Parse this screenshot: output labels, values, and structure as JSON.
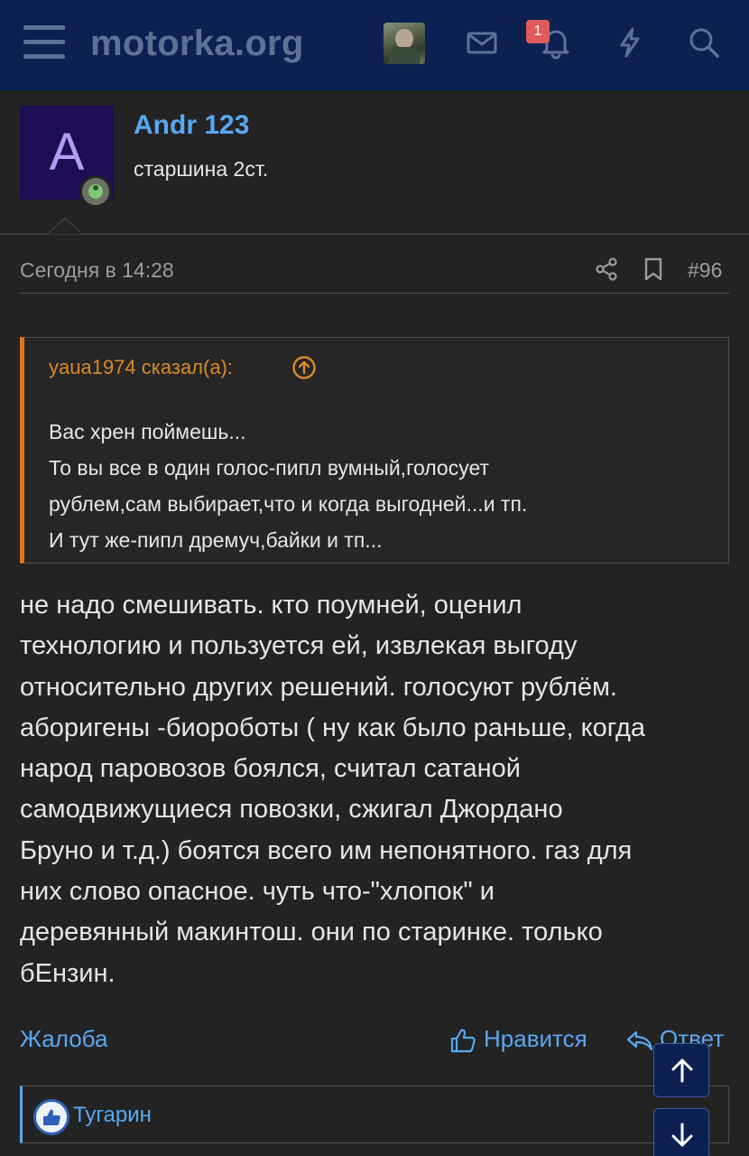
{
  "header": {
    "logo": "motorka.org",
    "notification_count": "1"
  },
  "post": {
    "author_name": "Andr 123",
    "author_initial": "A",
    "author_title": "старшина 2ст.",
    "date": "Сегодня в 14:28",
    "number": "#96",
    "quote": {
      "author": "yaua1974 сказал(а):",
      "lines": [
        "Вас хрен поймешь...",
        "То вы все в один голос-пипл вумный,голосует",
        "рублем,сам выбирает,что и когда выгодней...и тп.",
        "И тут же-пипл дремуч,байки и тп..."
      ]
    },
    "body_lines": [
      "не надо смешивать. кто поумней, оценил",
      "технологию и пользуется ей, извлекая выгоду",
      "относительно других решений. голосуют рублём.",
      "аборигены -биороботы ( ну как было раньше, когда",
      "народ паровозов боялся, считал сатаной",
      "самодвижущиеся повозки, сжигал Джордано",
      "Бруно и т.д.) боятся всего им непонятного. газ для",
      "них слово опасное. чуть что-\"хлопок\" и",
      "деревянный макинтош. они по старинке. только",
      "бЕнзин."
    ],
    "actions": {
      "report": "Жалоба",
      "like": "Нравится",
      "reply": "Ответ"
    },
    "reaction_user": "Тугарин"
  },
  "icons": {
    "menu": "hamburger-menu-icon",
    "avatar": "user-avatar",
    "inbox": "mail-icon",
    "alerts": "bell-icon",
    "whats_new": "lightning-icon",
    "search": "search-icon",
    "share": "share-icon",
    "bookmark": "bookmark-icon",
    "quote_jump": "arrow-up-circle-icon",
    "like": "thumbs-up-icon",
    "reply": "reply-icon",
    "scroll_up": "arrow-up-icon",
    "scroll_down": "arrow-down-icon"
  },
  "colors": {
    "header_bg": "#0c2152",
    "page_bg": "#232323",
    "link": "#58a8f2",
    "quote_accent": "#e3731a",
    "badge": "#e05a5a",
    "avatar_bg": "#1c0d54"
  }
}
